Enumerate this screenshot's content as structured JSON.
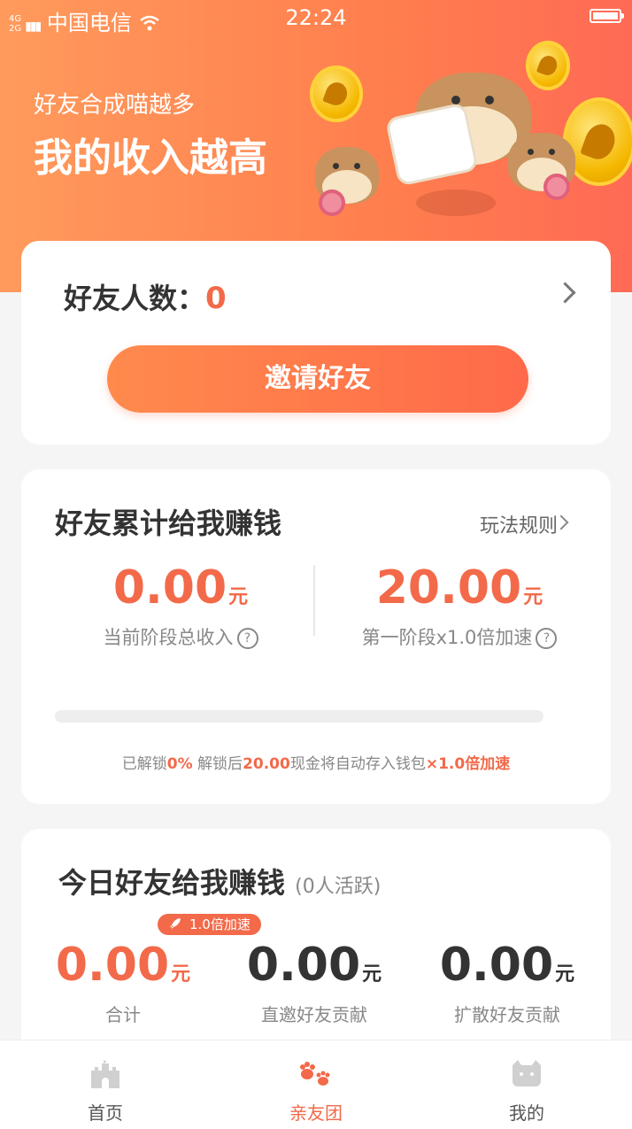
{
  "status_bar": {
    "network_top": "4G",
    "network_bottom": "2G",
    "carrier": "中国电信",
    "time": "22:24"
  },
  "hero": {
    "subtitle": "好友合成喵越多",
    "title": "我的收入越高"
  },
  "friends_card": {
    "label": "好友人数：",
    "count": "0",
    "invite_button": "邀请好友"
  },
  "cumulative_card": {
    "title": "好友累计给我赚钱",
    "rules_link": "玩法规则",
    "total_income": {
      "value": "0.00",
      "unit": "元",
      "label": "当前阶段总收入"
    },
    "stage_target": {
      "value": "20.00",
      "unit": "元",
      "label": "第一阶段x1.0倍加速"
    },
    "progress_percent": 0,
    "unlock_text": {
      "prefix": "已解锁",
      "percent": "0%",
      "middle": " 解锁后",
      "amount": "20.00",
      "suffix": "现金将自动存入钱包",
      "multiplier": "×1.0倍加速"
    }
  },
  "today_card": {
    "title": "今日好友给我赚钱",
    "active": "(0人活跃)",
    "badge": "1.0倍加速",
    "stats": [
      {
        "value": "0.00",
        "unit": "元",
        "label": "合计"
      },
      {
        "value": "0.00",
        "unit": "元",
        "label": "直邀好友贡献"
      },
      {
        "value": "0.00",
        "unit": "元",
        "label": "扩散好友贡献"
      }
    ]
  },
  "tabbar": {
    "tabs": [
      {
        "label": "首页",
        "icon": "castle-icon"
      },
      {
        "label": "亲友团",
        "icon": "paw-icon"
      },
      {
        "label": "我的",
        "icon": "cat-face-icon"
      }
    ],
    "active_index": 1
  },
  "colors": {
    "accent": "#f26a4a",
    "hero_start": "#ff9a5c",
    "hero_end": "#ff6a55"
  }
}
